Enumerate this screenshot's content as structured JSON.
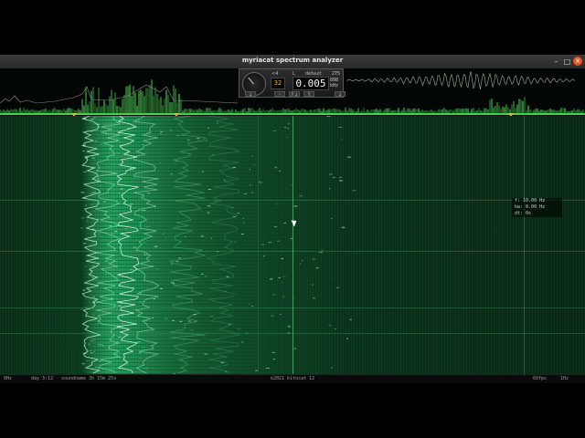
{
  "window": {
    "title": "myriacat spectrum analyzer",
    "minimize_label": "–",
    "maximize_label": "□",
    "close_label": "×"
  },
  "control_panel": {
    "channel_label": "<4",
    "mode_label": "L",
    "preset_label": "default",
    "gain_value": "32",
    "time_value": "0.005",
    "fps_value": "275",
    "fft_value": "898",
    "unit_label": "kHz",
    "buttons": [
      "↓",
      "-",
      "↑↓",
      "↑",
      "↓"
    ]
  },
  "info_box": {
    "freq": "f: 10.00 Hz",
    "bw": "bw: 0.00 Hz",
    "dt": "dt: 0s"
  },
  "status_bar": {
    "left_freq": "0Hz",
    "day": "day 3:12",
    "runtime": "soundname 3h 15m 25s",
    "copyright": "©2021 kitocat 12",
    "fps": "60fps",
    "right_freq": "1Hz"
  },
  "colors": {
    "spectrum_peak": "#5cf56a",
    "waterfall_bright": "#b8ffd0",
    "accent_orange": "#f2a33a",
    "close_button": "#e95420"
  }
}
